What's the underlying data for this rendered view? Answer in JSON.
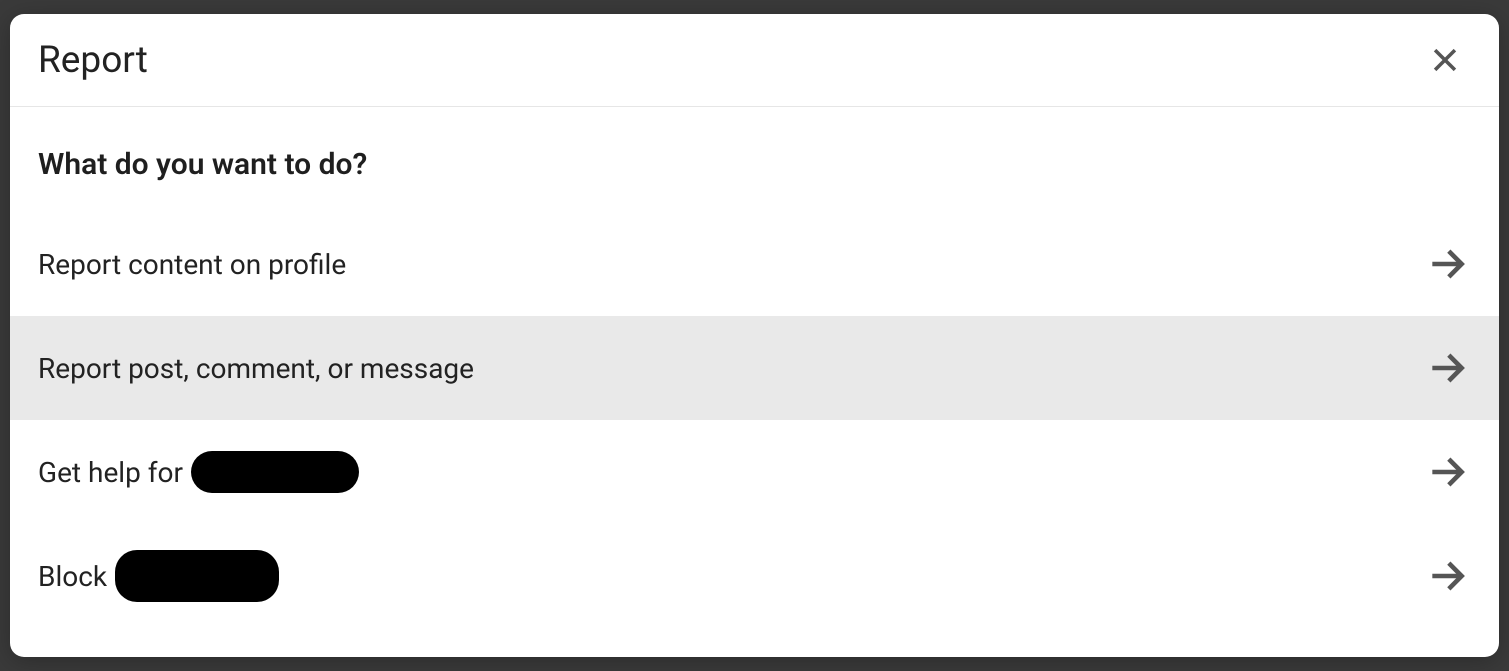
{
  "modal": {
    "title": "Report",
    "prompt": "What do you want to do?",
    "options": [
      {
        "label": "Report content on profile"
      },
      {
        "label": "Report post, comment, or message",
        "hovered": true
      },
      {
        "label_prefix": "Get help for ",
        "redacted": true
      },
      {
        "label_prefix": "Block ",
        "redacted": true
      }
    ]
  }
}
